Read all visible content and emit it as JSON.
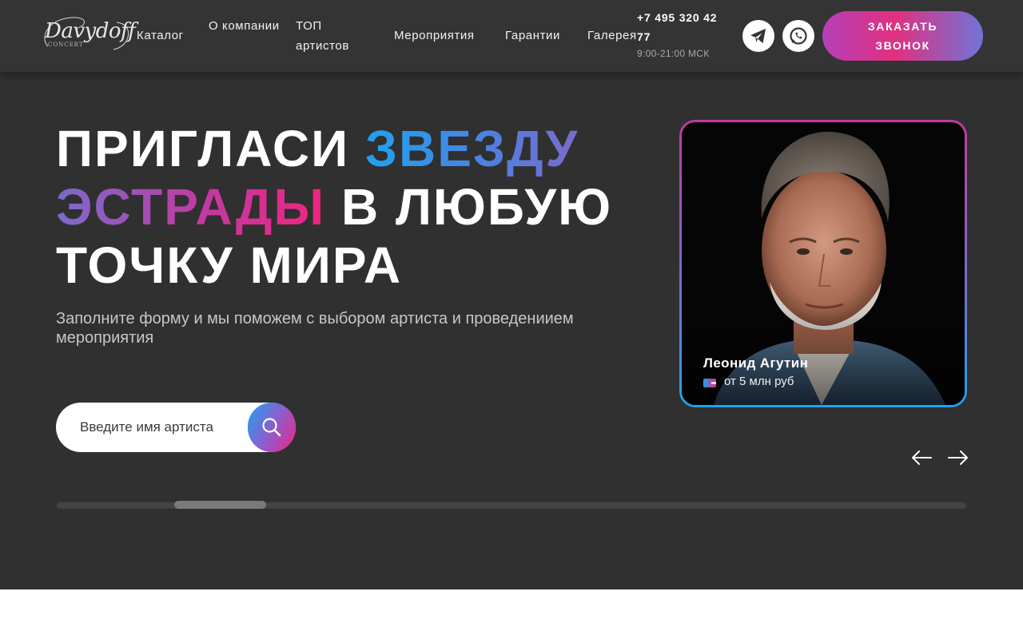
{
  "brand": {
    "logo_text": "Davydoff",
    "logo_sub": "CONCERT"
  },
  "nav": [
    {
      "label": "Каталог"
    },
    {
      "label": "О компании"
    },
    {
      "label": "ТОП артистов"
    },
    {
      "label": "Мероприятия"
    },
    {
      "label": "Гарантии"
    },
    {
      "label": "Галерея"
    }
  ],
  "contacts": {
    "phone": "+7 495 320 42 77",
    "hours": "9:00-21:00 МСК"
  },
  "socials": {
    "telegram_icon": "telegram-icon",
    "whatsapp_icon": "whatsapp-icon"
  },
  "cta_label": "ЗАКАЗАТЬ ЗВОНОК",
  "hero": {
    "headline_part1": "Пригласи ",
    "headline_part2": "звезду",
    "headline_part3": "эстрады",
    "headline_part4": " в любую точку мира",
    "subtitle": "Заполните форму и мы поможем с выбором артиста и проведениием мероприятия"
  },
  "search": {
    "placeholder": "Введите имя артиста",
    "value": ""
  },
  "artist_card": {
    "name": "Леонид Агутин",
    "price": "от 5 млн руб"
  },
  "slider": {
    "position": 0.13
  },
  "colors": {
    "accent_blue": "#1ea2ef",
    "accent_pink": "#ef2480",
    "accent_purple": "#7a6bcc",
    "background": "#303030"
  }
}
